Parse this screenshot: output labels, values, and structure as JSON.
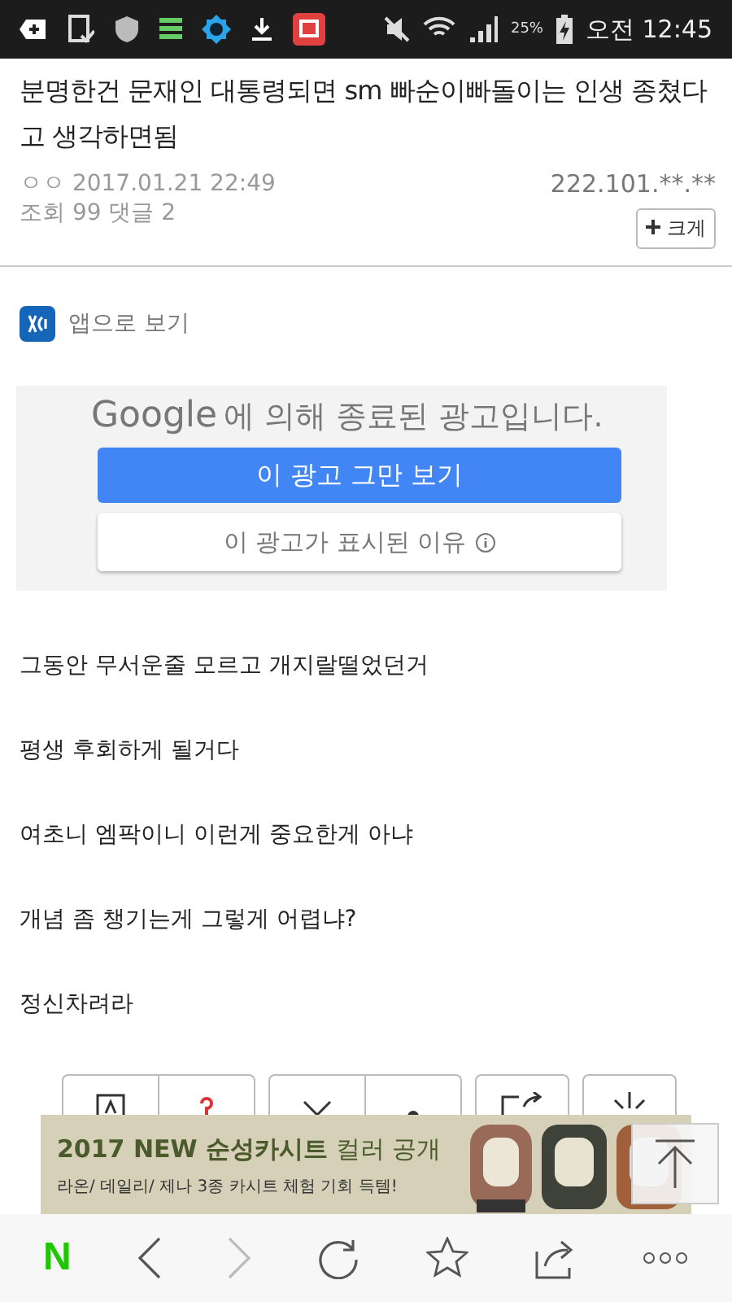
{
  "status_bar": {
    "battery": "25%",
    "time": "오전 12:45"
  },
  "post": {
    "title": "분명한건 문재인 대통령되면 sm 빠순이빠돌이는 인생 종쳤다고 생각하면됨",
    "author": "ㅇㅇ",
    "date": "2017.01.21 22:49",
    "ip": "222.101.**.**",
    "stats": "조회 99 댓글 2",
    "size_button": "크게"
  },
  "app_link": "앱으로 보기",
  "ad_notice": {
    "brand": "Google",
    "message": "에 의해 종료된 광고입니다.",
    "stop_button": "이 광고 그만 보기",
    "why_button": "이 광고가 표시된 이유"
  },
  "body": [
    "그동안 무서운줄 모르고 개지랄떨었던거",
    "평생 후회하게 될거다",
    "여초니 엠팍이니 이런게 중요한게 아냐",
    "개념 좀 챙기는게 그렇게 어렵냐?",
    "정신차려라"
  ],
  "banner": {
    "headline": "**2017 NEW 순성카시트** 컬러 공개",
    "subline": "라온/ 데일리/ 제나 3종 카시트 체험 기회 득템!"
  },
  "toolbar": {
    "logo": "N",
    "forward_disabled": true
  }
}
